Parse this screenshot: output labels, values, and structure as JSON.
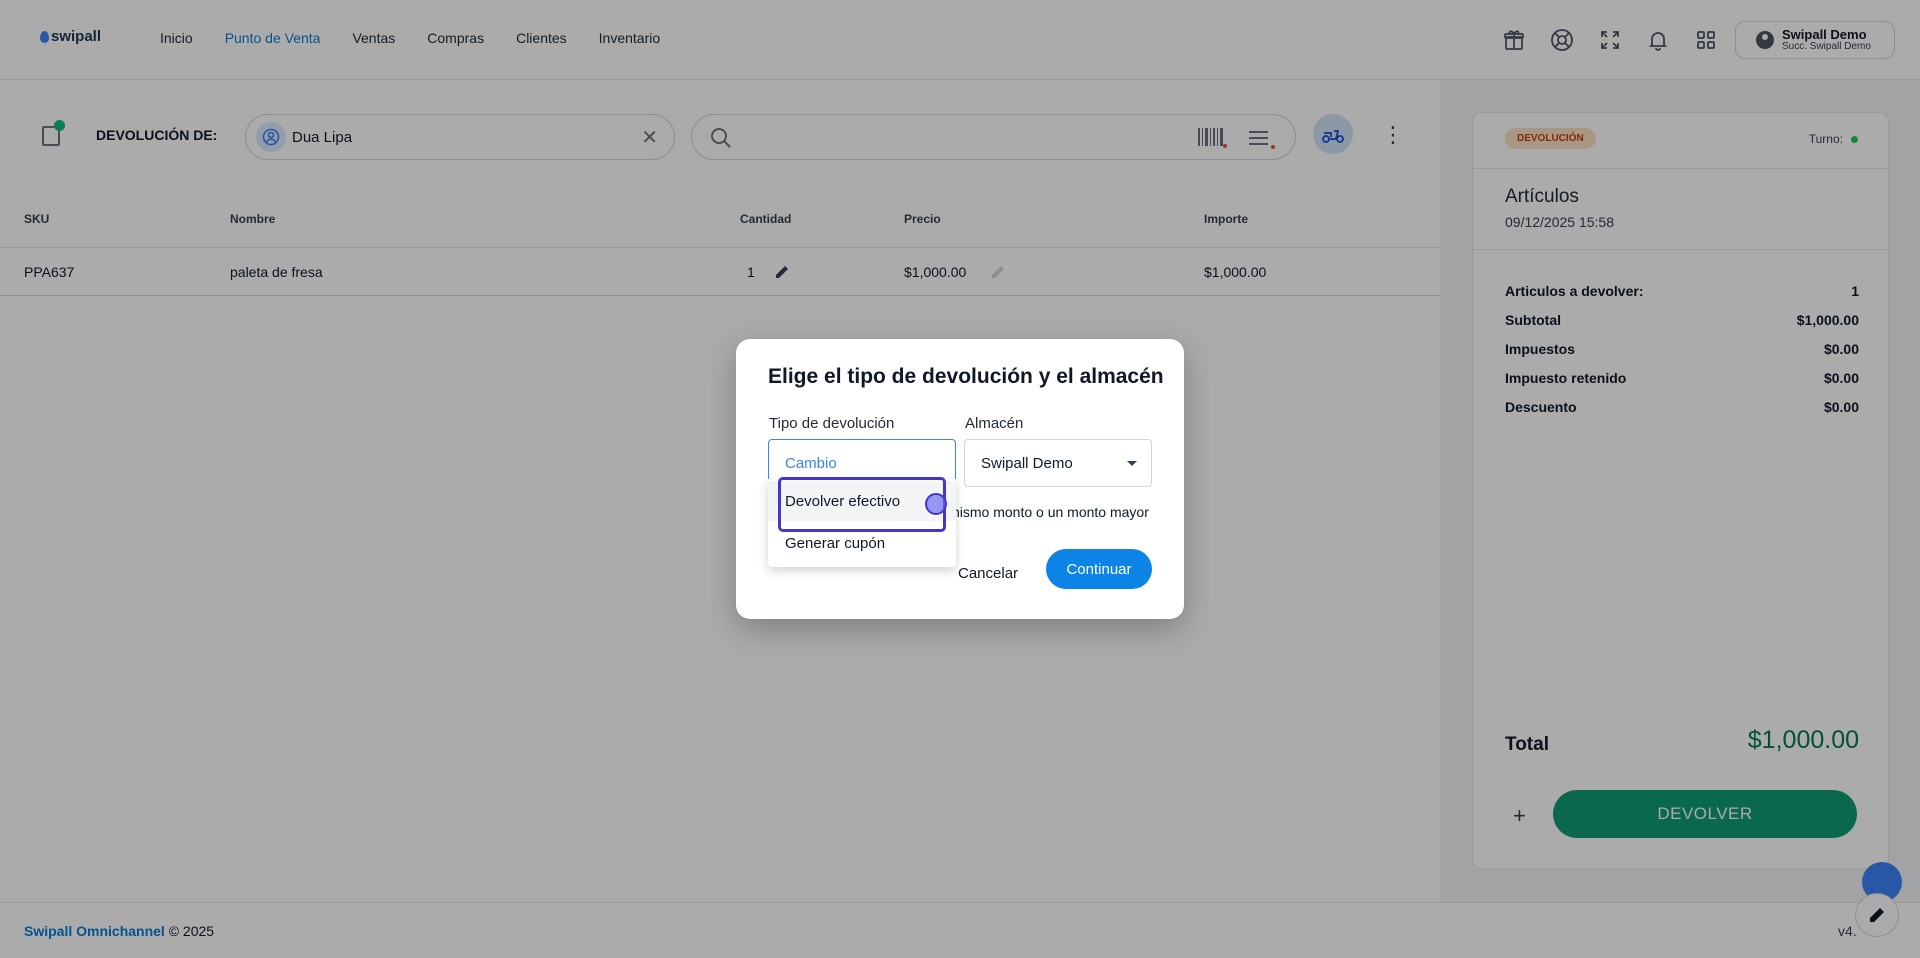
{
  "header": {
    "logo": "swipall",
    "nav": [
      "Inicio",
      "Punto de Venta",
      "Ventas",
      "Compras",
      "Clientes",
      "Inventario"
    ],
    "active_nav": "Punto de Venta",
    "icons": [
      "gift-icon",
      "help-icon",
      "fullscreen-icon",
      "bell-icon",
      "apps-icon"
    ],
    "user": {
      "name": "Swipall Demo",
      "branch": "Succ. Swipall Demo"
    }
  },
  "toolbar": {
    "label": "DEVOLUCIÓN DE:",
    "client": "Dua Lipa",
    "search_placeholder": ""
  },
  "table": {
    "headers": [
      "SKU",
      "Nombre",
      "Cantidad",
      "Precio",
      "Importe"
    ],
    "rows": [
      {
        "sku": "PPA637",
        "name": "paleta de fresa",
        "qty": "1",
        "price": "$1,000.00",
        "amount": "$1,000.00"
      }
    ]
  },
  "panel": {
    "badge": "DEVOLUCIÓN",
    "turno": "Turno:",
    "title": "Artículos",
    "date": "09/12/2025 15:58",
    "summary": [
      {
        "label": "Articulos a devolver:",
        "value": "1"
      },
      {
        "label": "Subtotal",
        "value": "$1,000.00"
      },
      {
        "label": "Impuestos",
        "value": "$0.00"
      },
      {
        "label": "Impuesto retenido",
        "value": "$0.00"
      },
      {
        "label": "Descuento",
        "value": "$0.00"
      }
    ],
    "total_label": "Total",
    "total_value": "$1,000.00",
    "plus": "+",
    "action": "DEVOLVER"
  },
  "footer": {
    "brand": "Swipall Omnichannel",
    "copyright": "© 2025",
    "version": "v4."
  },
  "modal": {
    "title": "Elige el tipo de devolución y el almacén",
    "type_label": "Tipo de devolución",
    "type_value": "Cambio",
    "warehouse_label": "Almacén",
    "warehouse_value": "Swipall Demo",
    "hint": "nismo monto o un monto mayor",
    "cancel": "Cancelar",
    "continue": "Continuar",
    "options": [
      "Devolver efectivo",
      "Generar cupón"
    ]
  },
  "colors": {
    "accent": "#0b84e6",
    "success": "#0f9d72",
    "total": "#047857",
    "badge_bg": "#fde2c7"
  }
}
